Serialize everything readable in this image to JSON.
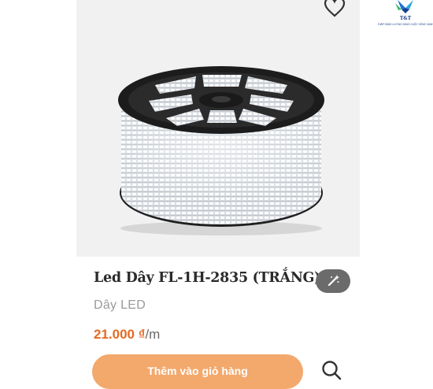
{
  "product": {
    "title": "Led Dây FL-1H-2835 (TRẮNG)",
    "category": "Dây LED",
    "price_amount": "21.000 ₫",
    "price_unit": "/m"
  },
  "actions": {
    "add_to_cart_label": "Thêm vào giỏ hàng"
  },
  "logo": {
    "name": "T&T",
    "slogan": "THẮP SÁNG LƯƠNG SÁNG CUỘC SỐNG XANH"
  },
  "icons": {
    "wishlist": "heart-icon",
    "compare": "magic-wand-icon",
    "quick_view": "search-icon"
  },
  "colors": {
    "accent": "#e46a23",
    "button": "#f3a86c",
    "compare_pill": "#6b6b6b",
    "image_bg": "#f1f1f1"
  }
}
